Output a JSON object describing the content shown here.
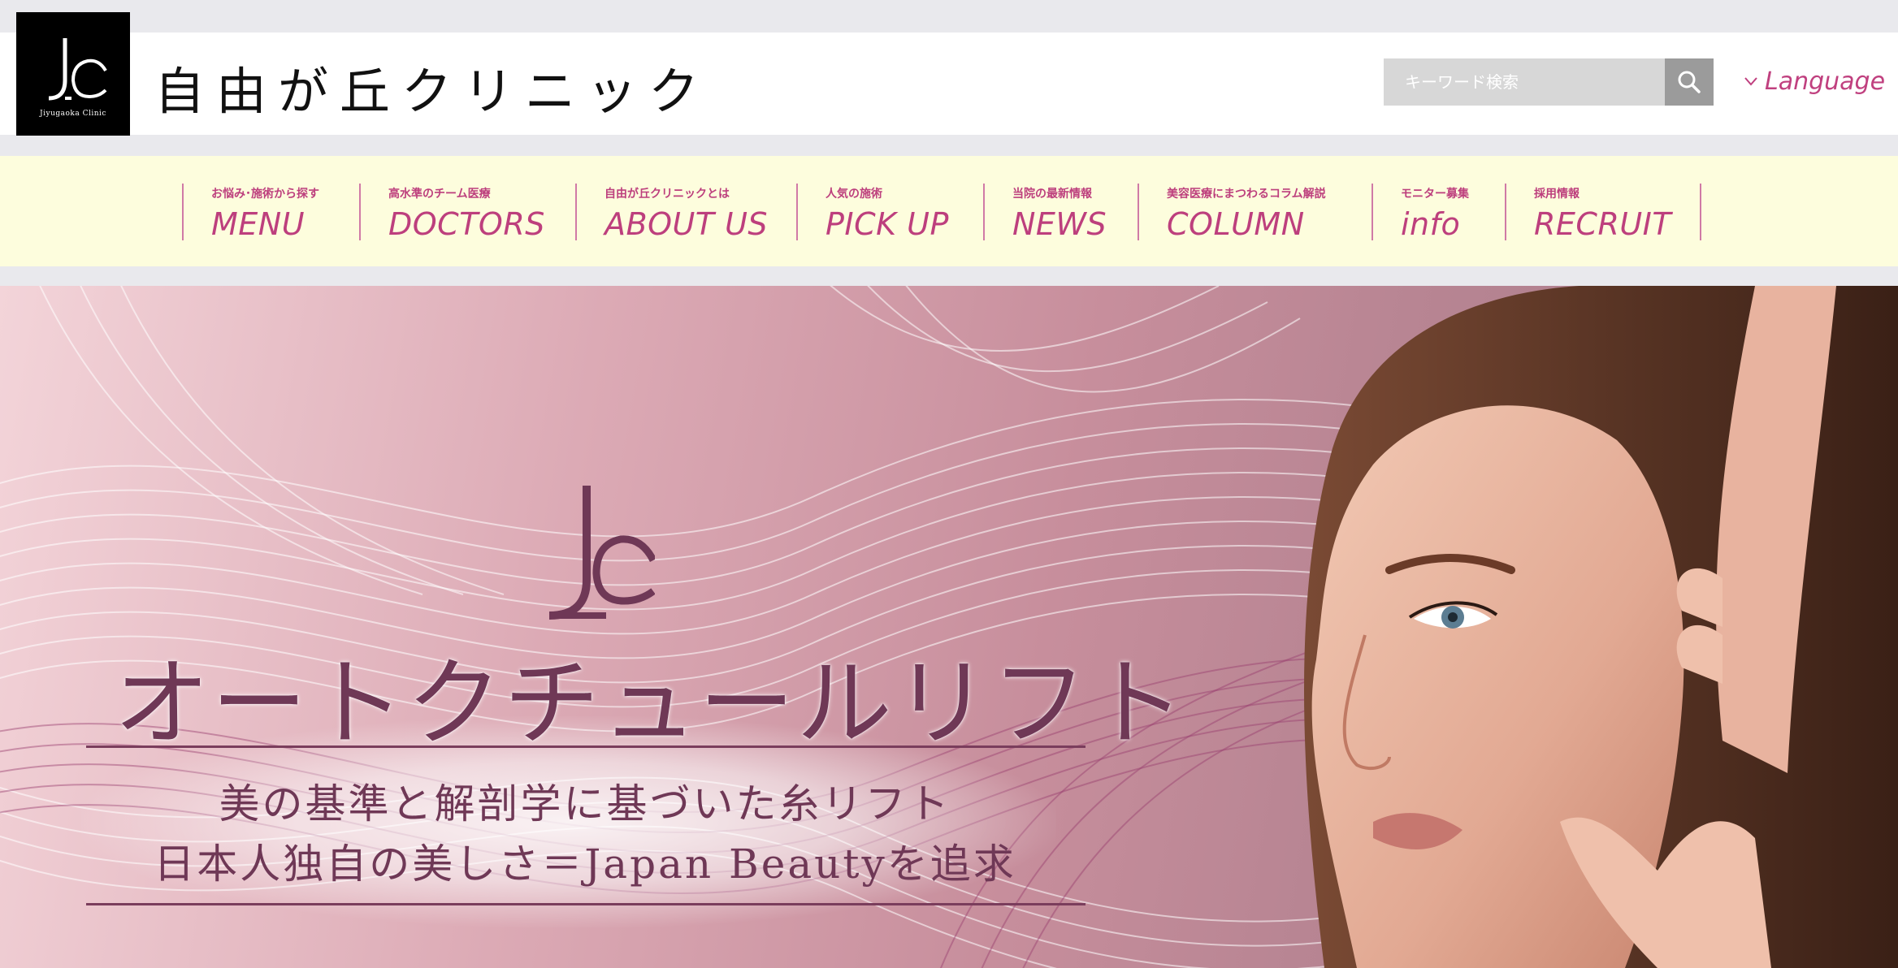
{
  "header": {
    "logo_text": "Jiyugaoka Clinic",
    "brand_title": "自由が丘クリニック",
    "search_placeholder": "キーワード検索",
    "language_label": "Language"
  },
  "nav": {
    "items": [
      {
        "sub": "お悩み･施術から探す",
        "label": "MENU"
      },
      {
        "sub": "高水準のチーム医療",
        "label": "DOCTORS"
      },
      {
        "sub": "自由が丘クリニックとは",
        "label": "ABOUT US"
      },
      {
        "sub": "人気の施術",
        "label": "PICK UP"
      },
      {
        "sub": "当院の最新情報",
        "label": "NEWS"
      },
      {
        "sub": "美容医療にまつわるコラム解説",
        "label": "COLUMN"
      },
      {
        "sub": "モニター募集",
        "label": "info"
      },
      {
        "sub": "採用情報",
        "label": "RECRUIT"
      }
    ]
  },
  "hero": {
    "title": "オートクチュールリフト",
    "line1": "美の基準と解剖学に基づいた糸リフト",
    "line2": "日本人独自の美しさ＝Japan Beautyを追求"
  },
  "colors": {
    "accent": "#c0407f",
    "nav_bg": "#fdfddd",
    "hero_text": "#6f3856"
  }
}
